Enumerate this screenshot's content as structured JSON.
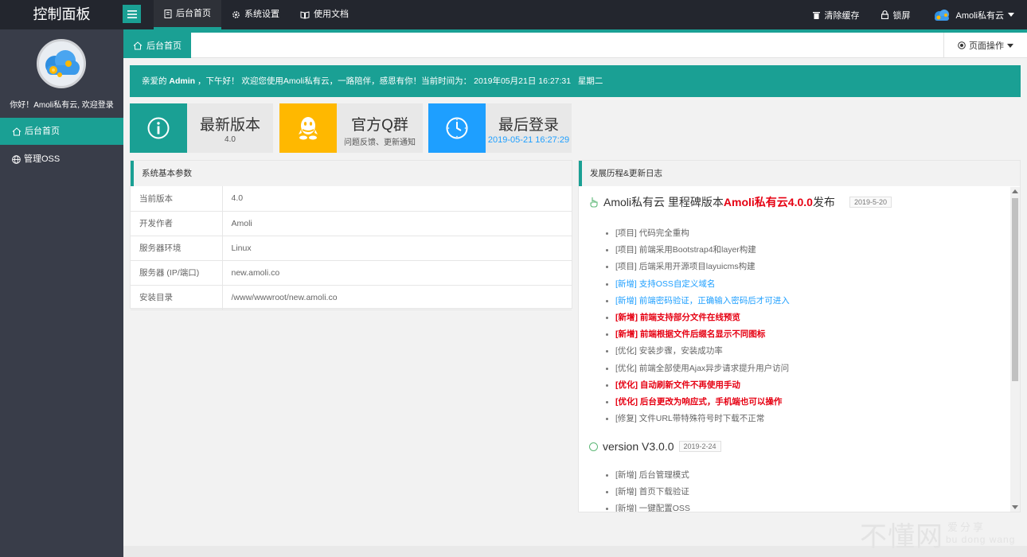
{
  "app": {
    "title": "控制面板"
  },
  "topnav": [
    {
      "label": "后台首页",
      "icon": "document-icon",
      "active": true
    },
    {
      "label": "系统设置",
      "icon": "gear-icon",
      "active": false
    },
    {
      "label": "使用文档",
      "icon": "book-icon",
      "active": false
    }
  ],
  "top_right": {
    "clear_cache": "清除缓存",
    "lock": "锁屏",
    "username": "Amoli私有云"
  },
  "sidebar": {
    "welcome": "你好！Amoli私有云, 欢迎登录",
    "items": [
      {
        "label": "后台首页",
        "icon": "home-icon",
        "active": true
      },
      {
        "label": "管理OSS",
        "icon": "globe-icon",
        "active": false
      }
    ]
  },
  "tabs": {
    "home": "后台首页",
    "page_ops": "页面操作"
  },
  "welcome_bar": {
    "prefix": "亲爱的",
    "user": "Admin",
    "text": "，下午好！ 欢迎您使用Amoli私有云，一路陪伴，感恩有你！当前时间为： 2019年05月21日 16:27:31   星期二"
  },
  "cards": [
    {
      "title": "最新版本",
      "sub": "4.0",
      "icon": "info-icon",
      "color": "#1aa094"
    },
    {
      "title": "官方Q群",
      "sub": "问题反馈、更新通知",
      "icon": "qq-icon",
      "color": "#ffb800"
    },
    {
      "title": "最后登录",
      "sub": "2019-05-21 16:27:29",
      "icon": "clock-icon",
      "color": "#1e9fff"
    }
  ],
  "params": {
    "title": "系统基本参数",
    "rows": [
      {
        "key": "当前版本",
        "value": "4.0"
      },
      {
        "key": "开发作者",
        "value": "Amoli"
      },
      {
        "key": "服务器环境",
        "value": "Linux"
      },
      {
        "key": "服务器 (IP/端口)",
        "value": "new.amoli.co"
      },
      {
        "key": "安装目录",
        "value": "/www/wwwroot/new.amoli.co"
      }
    ]
  },
  "changelog": {
    "title": "发展历程&更新日志",
    "versions": [
      {
        "title_prefix": "Amoli私有云 里程碑版本",
        "title_highlight": "Amoli私有云4.0.0",
        "title_suffix": "发布",
        "date": "2019-5-20",
        "items": [
          {
            "text": "[项目] 代码完全重构",
            "style": "normal"
          },
          {
            "text": "[项目] 前端采用Bootstrap4和layer构建",
            "style": "normal"
          },
          {
            "text": "[项目] 后端采用开源项目layuicms构建",
            "style": "normal"
          },
          {
            "text": "[新增] 支持OSS自定义域名",
            "style": "blue"
          },
          {
            "text": "[新增] 前端密码验证，正确输入密码后才可进入",
            "style": "blue"
          },
          {
            "text": "[新增] 前端支持部分文件在线预览",
            "style": "red"
          },
          {
            "text": "[新增] 前端根据文件后缀名显示不同图标",
            "style": "red"
          },
          {
            "text": "[优化] 安装步骤，安装成功率",
            "style": "normal"
          },
          {
            "text": "[优化] 前端全部使用Ajax异步请求提升用户访问",
            "style": "normal"
          },
          {
            "text": "[优化] 自动刷新文件不再使用手动",
            "style": "red"
          },
          {
            "text": "[优化] 后台更改为响应式，手机端也可以操作",
            "style": "red"
          },
          {
            "text": "[修复] 文件URL带特殊符号时下载不正常",
            "style": "normal"
          }
        ]
      },
      {
        "title_prefix": "version V3.0.0",
        "title_highlight": "",
        "title_suffix": "",
        "date": "2019-2-24",
        "items": [
          {
            "text": "[新增] 后台管理模式",
            "style": "normal"
          },
          {
            "text": "[新增] 首页下载验证",
            "style": "normal"
          },
          {
            "text": "[新增] 一键配置OSS",
            "style": "normal"
          }
        ]
      }
    ]
  },
  "watermark": {
    "big": "不懂网",
    "small1": "爱分享",
    "small2": "bu dong wang"
  }
}
